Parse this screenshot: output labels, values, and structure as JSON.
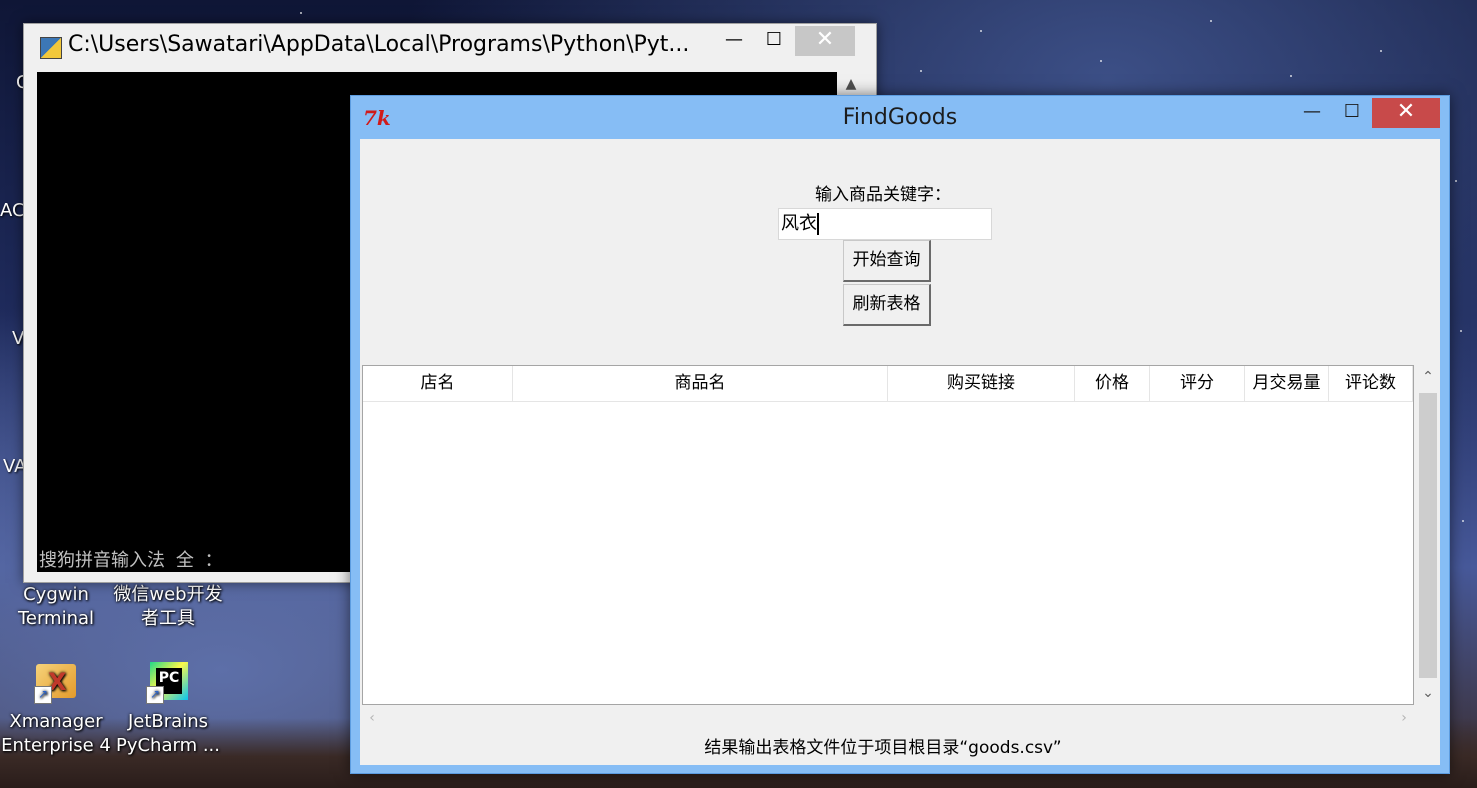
{
  "desktop": {
    "edge_labels": [
      "C",
      "AC",
      "V",
      "VA"
    ],
    "icons": [
      {
        "label_line1": "Cygwin",
        "label_line2": "Terminal"
      },
      {
        "label_line1": "微信web开发",
        "label_line2": "者工具"
      },
      {
        "label_line1": "Xmanager",
        "label_line2": "Enterprise 4"
      },
      {
        "label_line1": "JetBrains",
        "label_line2": "PyCharm ..."
      }
    ]
  },
  "console": {
    "title": "C:\\Users\\Sawatari\\AppData\\Local\\Programs\\Python\\Pyt...",
    "ime_status": "搜狗拼音输入法 全 ："
  },
  "tk_window": {
    "title": "FindGoods",
    "icon_text": "7k",
    "keyword_label": "输入商品关键字：",
    "keyword_value": "风衣",
    "query_button": "开始查询",
    "refresh_button": "刷新表格",
    "table": {
      "columns": [
        "店名",
        "商品名",
        "购买链接",
        "价格",
        "评分",
        "月交易量",
        "评论数"
      ],
      "rows": []
    },
    "footer_text": "结果输出表格文件位于项目根目录“goods.csv”"
  },
  "window_controls": {
    "minimize": "—",
    "maximize": "☐",
    "close": "✕"
  }
}
